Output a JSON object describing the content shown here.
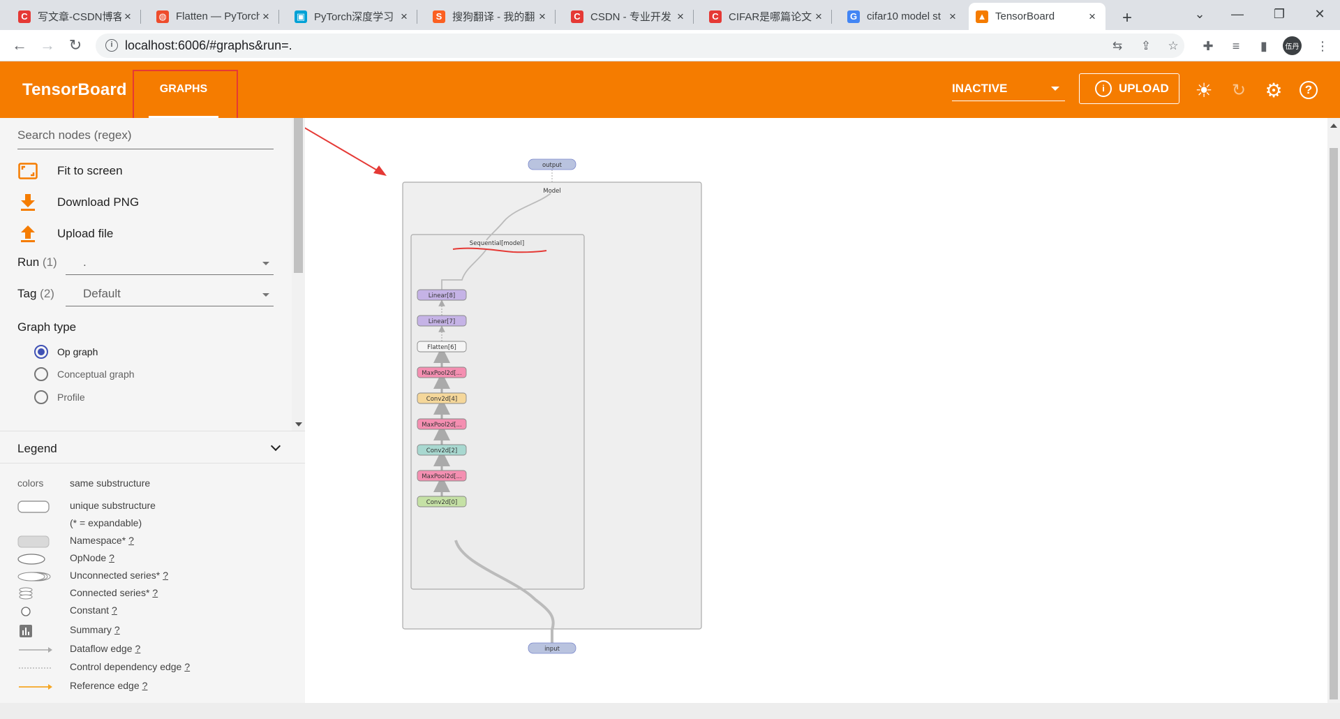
{
  "browser": {
    "tabs": [
      {
        "title": "写文章-CSDN博客",
        "favicon": "csdn-icon",
        "color": "#e53935",
        "glyph": "C"
      },
      {
        "title": "Flatten — PyTorch",
        "favicon": "pytorch-icon",
        "color": "#ee4c2c",
        "glyph": "◍"
      },
      {
        "title": "PyTorch深度学习",
        "favicon": "bilibili-icon",
        "color": "#00a1d6",
        "glyph": "▣"
      },
      {
        "title": "搜狗翻译 - 我的翻",
        "favicon": "sogou-icon",
        "color": "#fb6022",
        "glyph": "S"
      },
      {
        "title": "CSDN - 专业开发",
        "favicon": "csdn-icon",
        "color": "#e53935",
        "glyph": "C"
      },
      {
        "title": "CIFAR是哪篇论文",
        "favicon": "csdn-icon",
        "color": "#e53935",
        "glyph": "C"
      },
      {
        "title": "cifar10 model st",
        "favicon": "google-icon",
        "color": "#4285f4",
        "glyph": "G"
      },
      {
        "title": "TensorBoard",
        "favicon": "tensorboard-icon",
        "color": "#f57c00",
        "glyph": "▲"
      }
    ],
    "active_tab_index": 7,
    "new_tab": "+",
    "close_glyph": "×",
    "url": "localhost:6006/#graphs&run=.",
    "profile": "伍丹"
  },
  "app": {
    "brand": "TensorBoard",
    "nav_tab": "GRAPHS",
    "status": "INACTIVE",
    "upload": "UPLOAD",
    "accent": "#f57c00"
  },
  "sidebar": {
    "search_placeholder": "Search nodes (regex)",
    "actions": [
      {
        "label": "Fit to screen",
        "icon": "fit-screen-icon"
      },
      {
        "label": "Download PNG",
        "icon": "download-icon"
      },
      {
        "label": "Upload file",
        "icon": "upload-icon"
      }
    ],
    "run": {
      "label": "Run",
      "count": "(1)",
      "value": "."
    },
    "tag": {
      "label": "Tag",
      "count": "(2)",
      "value": "Default"
    },
    "graph_type": {
      "title": "Graph type",
      "options": [
        {
          "label": "Op graph",
          "checked": true
        },
        {
          "label": "Conceptual graph",
          "checked": false
        },
        {
          "label": "Profile",
          "checked": false
        }
      ]
    },
    "legend": {
      "title": "Legend",
      "rows": [
        {
          "key": "colors",
          "label": "same substructure",
          "help": ""
        },
        {
          "key": "",
          "label": "unique substructure",
          "help": ""
        },
        {
          "key": "",
          "label": "(* = expandable)",
          "help": ""
        },
        {
          "key": "",
          "label": "Namespace*",
          "help": "?"
        },
        {
          "key": "",
          "label": "OpNode",
          "help": "?"
        },
        {
          "key": "",
          "label": "Unconnected series*",
          "help": "?"
        },
        {
          "key": "",
          "label": "Connected series*",
          "help": "?"
        },
        {
          "key": "",
          "label": "Constant",
          "help": "?"
        },
        {
          "key": "",
          "label": "Summary",
          "help": "?"
        },
        {
          "key": "",
          "label": "Dataflow edge",
          "help": "?"
        },
        {
          "key": "",
          "label": "Control dependency edge",
          "help": "?"
        },
        {
          "key": "",
          "label": "Reference edge",
          "help": "?"
        }
      ]
    }
  },
  "graph": {
    "outer_namespace": "Model",
    "inner_namespace": "Sequential[model]",
    "output_node": "output",
    "input_node": "input",
    "layers": [
      {
        "label": "Linear[8]",
        "color": "#c5b3e6"
      },
      {
        "label": "Linear[7]",
        "color": "#c5b3e6"
      },
      {
        "label": "Flatten[6]",
        "color": "#f5f5f5"
      },
      {
        "label": "MaxPool2d[...",
        "color": "#f48fb1"
      },
      {
        "label": "Conv2d[4]",
        "color": "#f5d79a"
      },
      {
        "label": "MaxPool2d[...",
        "color": "#f48fb1"
      },
      {
        "label": "Conv2d[2]",
        "color": "#a8d8d0"
      },
      {
        "label": "MaxPool2d[...",
        "color": "#f48fb1"
      },
      {
        "label": "Conv2d[0]",
        "color": "#c5e1a5"
      }
    ],
    "io_color": "#b9c3df"
  }
}
